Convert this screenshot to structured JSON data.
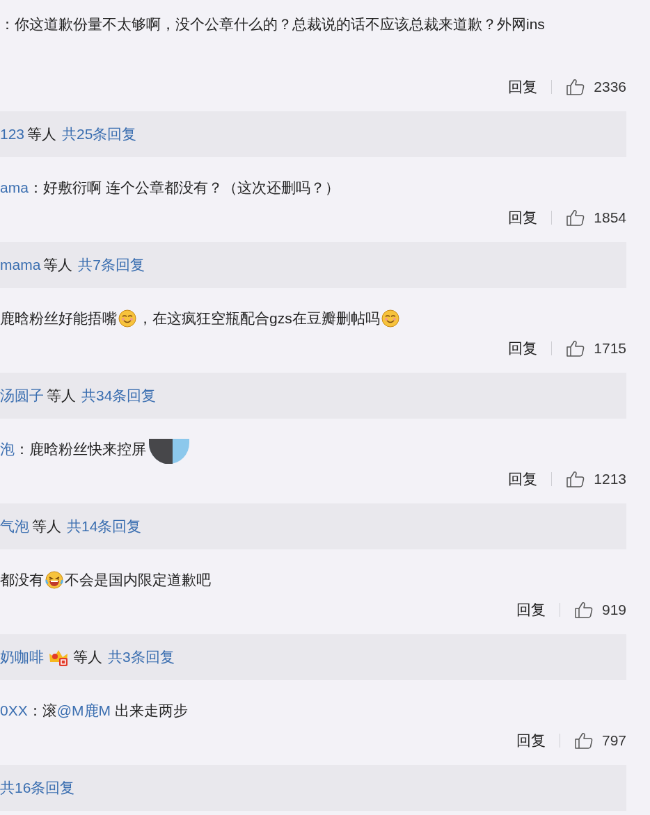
{
  "comments": [
    {
      "segments": [
        {
          "kind": "text",
          "text": "：你这道歉份量不太够啊，没个公章什么的？总裁说的话不应该总裁来道歉？外网ins"
        }
      ],
      "reply_label": "回复",
      "likes": "2336",
      "summary": {
        "users": [
          {
            "kind": "name",
            "text": "123"
          }
        ],
        "others": "等人",
        "count": "共25条回复"
      }
    },
    {
      "segments": [
        {
          "kind": "name",
          "text": "ama"
        },
        {
          "kind": "text",
          "text": "：好敷衍啊 连个公章都没有？（这次还删吗？）"
        }
      ],
      "reply_label": "回复",
      "likes": "1854",
      "summary": {
        "users": [
          {
            "kind": "name",
            "text": "mama"
          }
        ],
        "others": "等人",
        "count": "共7条回复"
      }
    },
    {
      "segments": [
        {
          "kind": "text",
          "text": "鹿晗粉丝好能捂嘴"
        },
        {
          "kind": "smirk"
        },
        {
          "kind": "text",
          "text": "，在这疯狂空瓶配合gzs在豆瓣删帖吗"
        },
        {
          "kind": "smirk"
        }
      ],
      "reply_label": "回复",
      "likes": "1715",
      "summary": {
        "users": [
          {
            "kind": "name",
            "text": "汤圆子"
          }
        ],
        "others": "等人",
        "count": "共34条回复"
      }
    },
    {
      "segments": [
        {
          "kind": "name",
          "text": "泡"
        },
        {
          "kind": "text",
          "text": "：鹿晗粉丝快来控屏"
        },
        {
          "kind": "censor"
        }
      ],
      "reply_label": "回复",
      "likes": "1213",
      "summary": {
        "users": [
          {
            "kind": "name",
            "text": "气泡"
          }
        ],
        "others": "等人",
        "count": "共14条回复"
      }
    },
    {
      "segments": [
        {
          "kind": "text",
          "text": "都没有"
        },
        {
          "kind": "laugh"
        },
        {
          "kind": "text",
          "text": "不会是国内限定道歉吧"
        }
      ],
      "reply_label": "回复",
      "likes": "919",
      "summary": {
        "users": [
          {
            "kind": "name",
            "text": "奶咖啡"
          },
          {
            "kind": "badge"
          }
        ],
        "others": "等人",
        "count": "共3条回复"
      }
    },
    {
      "segments": [
        {
          "kind": "name",
          "text": "0XX"
        },
        {
          "kind": "text",
          "text": "：滚"
        },
        {
          "kind": "mention",
          "text": "@M鹿M"
        },
        {
          "kind": "text",
          "text": " 出来走两步"
        }
      ],
      "reply_label": "回复",
      "likes": "797",
      "summary": {
        "count": "共16条回复"
      }
    }
  ]
}
